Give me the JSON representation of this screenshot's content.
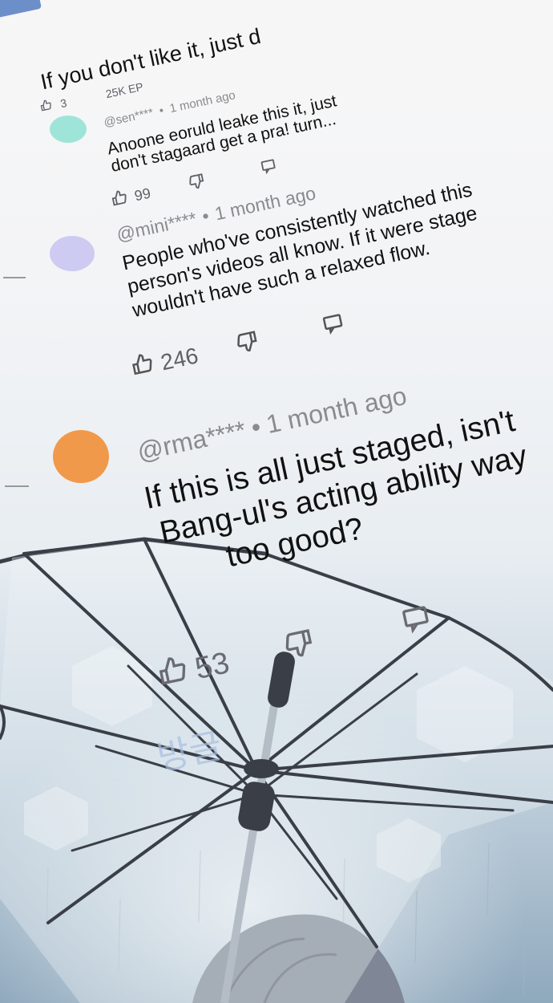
{
  "top_comment": {
    "text": "If you don't like it, just d",
    "likes": "3",
    "views": "25K EP"
  },
  "comments": [
    {
      "handle": "@sen****",
      "time": "1 month ago",
      "text_lines": [
        "Anoone eoruld leake this it, just",
        "don't stagaard get a pra! turn..."
      ],
      "likes": "99",
      "avatar_color": "#8fe0d4"
    },
    {
      "handle": "@mini****",
      "time": "1 month ago",
      "text_lines": [
        "People who've consistently watched this",
        "person's videos all know. If it were stage",
        "wouldn't have such a relaxed flow."
      ],
      "likes": "246",
      "avatar_color": "#c9c6f2"
    },
    {
      "handle": "@rma****",
      "time": "1 month ago",
      "text_lines": [
        "If this is all just staged, isn't",
        "Bang-ul's acting ability way",
        "too good?"
      ],
      "likes": "53",
      "avatar_color": "#f1994a"
    }
  ],
  "separator": "•",
  "colors": {
    "accent_tab": "#6d8fc9",
    "sky": "#b9cbd8",
    "rain": "#9fb6c6"
  },
  "icons": [
    "thumbs-up-icon",
    "thumbs-down-icon",
    "reply-icon",
    "umbrella-illustration"
  ]
}
